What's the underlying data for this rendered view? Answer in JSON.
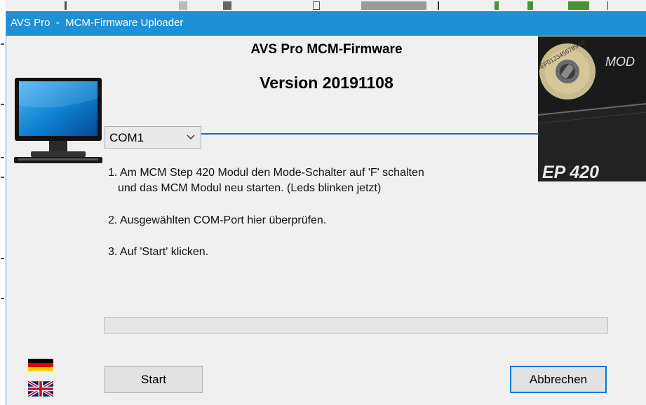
{
  "window": {
    "title": "AVS Pro  -  MCM-Firmware Uploader"
  },
  "header": {
    "product_line": "AVS Pro  MCM-Firmware",
    "version_line": "Version 20191108"
  },
  "photo": {
    "model_text": "MOD",
    "step_text": "EP 420",
    "dial_text": "CDEF0123456789AB"
  },
  "port": {
    "selected": "COM1"
  },
  "instructions": {
    "step1_line1": "1. Am MCM Step 420 Modul den Mode-Schalter auf 'F' schalten",
    "step1_line2": "und das MCM Modul neu starten. (Leds blinken jetzt)",
    "step2": "2. Ausgewählten COM-Port hier überprüfen.",
    "step3": "3. Auf 'Start' klicken."
  },
  "progress": {
    "value": 0
  },
  "buttons": {
    "start": "Start",
    "cancel": "Abbrechen"
  },
  "icons": {
    "monitor": "monitor-icon",
    "flag_de": "german-flag-icon",
    "flag_uk": "uk-flag-icon",
    "chevron": "chevron-down-icon"
  },
  "colors": {
    "titlebar": "#1f8fd6",
    "accent": "#0078d7",
    "line": "#1c6fc1"
  }
}
